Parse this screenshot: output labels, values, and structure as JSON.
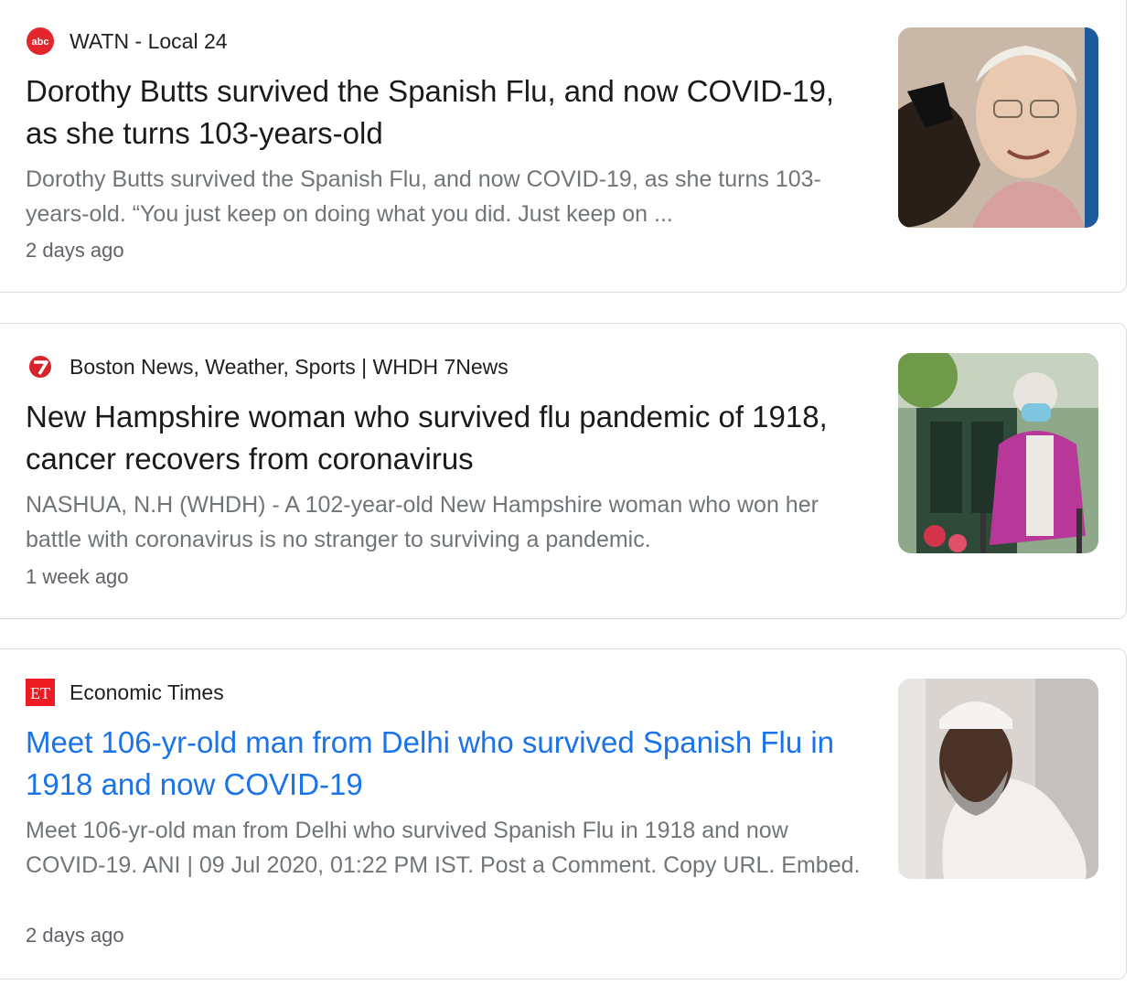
{
  "articles": [
    {
      "source": "WATN - Local 24",
      "logo_icon": "abc-logo-icon",
      "headline": "Dorothy Butts survived the Spanish Flu, and now COVID-19, as she turns 103-years-old",
      "snippet": "Dorothy Butts survived the Spanish Flu, and now COVID-19, as she turns 103-years-old. “You just keep on doing what you did. Just keep on ...",
      "time": "2 days ago",
      "thumbnail": "elderly-woman-photo"
    },
    {
      "source": "Boston News, Weather, Sports | WHDH 7News",
      "logo_icon": "7news-logo-icon",
      "headline": "New Hampshire woman who survived flu pandemic of 1918, cancer recovers from coronavirus",
      "snippet": "NASHUA, N.H (WHDH) - A 102-year-old New Hampshire woman who won her battle with coronavirus is no stranger to surviving a pandemic.",
      "time": "1 week ago",
      "thumbnail": "woman-with-walker-photo"
    },
    {
      "source": "Economic Times",
      "logo_icon": "et-logo-icon",
      "logo_text": "ET",
      "headline": "Meet 106-yr-old man from Delhi who survived Spanish Flu in 1918 and now COVID-19",
      "snippet": "Meet 106-yr-old man from Delhi who survived Spanish Flu in 1918 and now COVID-19. ANI | 09 Jul 2020, 01:22 PM IST. Post a Comment. Copy URL. Embed.",
      "time": "2 days ago",
      "thumbnail": "elderly-man-photo"
    }
  ],
  "colors": {
    "link_blue": "#1a73e8",
    "headline_dark": "#1a1a1a",
    "snippet_gray": "#70757a",
    "abc_red": "#e3262b",
    "seven_red": "#d8232a",
    "et_red": "#ed1c24"
  }
}
